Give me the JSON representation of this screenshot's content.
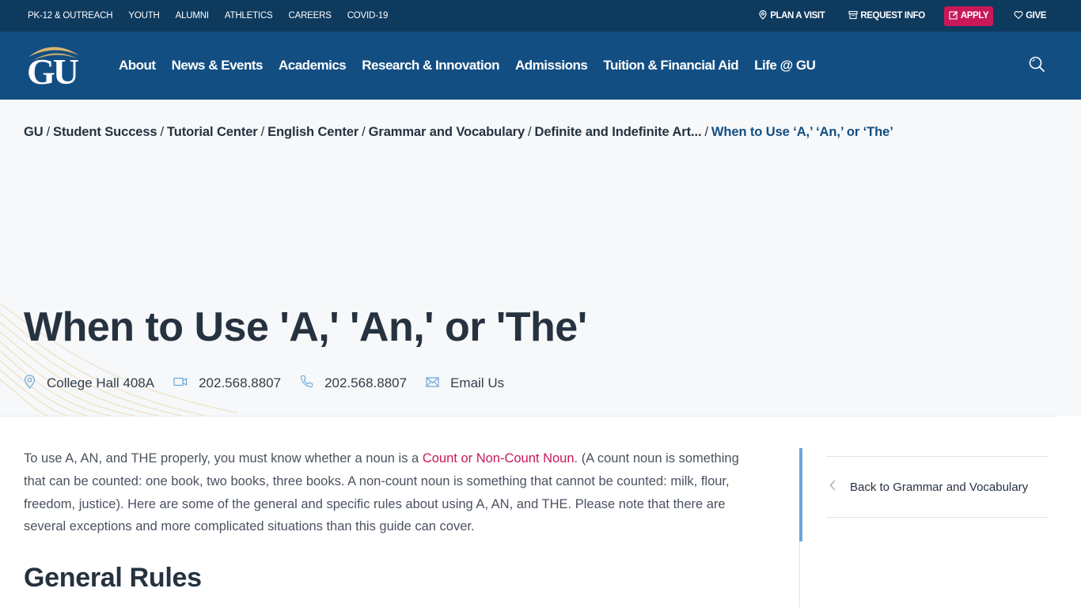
{
  "utility_bar": {
    "left_links": [
      "PK-12 & OUTREACH",
      "YOUTH",
      "ALUMNI",
      "ATHLETICS",
      "CAREERS",
      "COVID-19"
    ],
    "plan_visit": "PLAN A VISIT",
    "request_info": "REQUEST INFO",
    "apply": "APPLY",
    "give": "GIVE"
  },
  "header": {
    "logo_text": "GU",
    "nav": [
      "About",
      "News & Events",
      "Academics",
      "Research & Innovation",
      "Admissions",
      "Tuition & Financial Aid",
      "Life @ GU"
    ],
    "search_icon": "search-icon"
  },
  "breadcrumb": {
    "items": [
      "GU",
      "Student Success",
      "Tutorial Center",
      "English Center",
      "Grammar and Vocabulary",
      "Definite and Indefinite Art..."
    ],
    "separator": "/",
    "current": "When to Use ‘A,’ ‘An,’ or ‘The’"
  },
  "page": {
    "title": "When to Use 'A,' 'An,' or 'The'",
    "contact": {
      "location": "College Hall 408A",
      "video_phone": "202.568.8807",
      "phone": "202.568.8807",
      "email": "Email Us"
    }
  },
  "content": {
    "intro_before_link": "To use A, AN, and THE properly, you must know whether a noun is a ",
    "intro_link": "Count or Non-Count Noun",
    "intro_after_link": ". (A count noun is something that can be counted: one book, two books, three books. A non-count noun is something that cannot be counted: milk, flour, freedom, justice). Here are some of the general and specific rules about using A, AN, and THE. Please note that there are several exceptions and more complicated situations than this guide can cover.",
    "section_heading": "General Rules"
  },
  "sidebar": {
    "back_link": "Back to Grammar and Vocabulary"
  },
  "colors": {
    "utility_bg": "#0e3a5e",
    "nav_bg": "#134e82",
    "apply_bg": "#c8185a",
    "link_accent": "#c8185a",
    "breadcrumb_current": "#134e82",
    "sidebar_accent": "#6aa5d8",
    "logo_gold": "#d9b56c"
  }
}
